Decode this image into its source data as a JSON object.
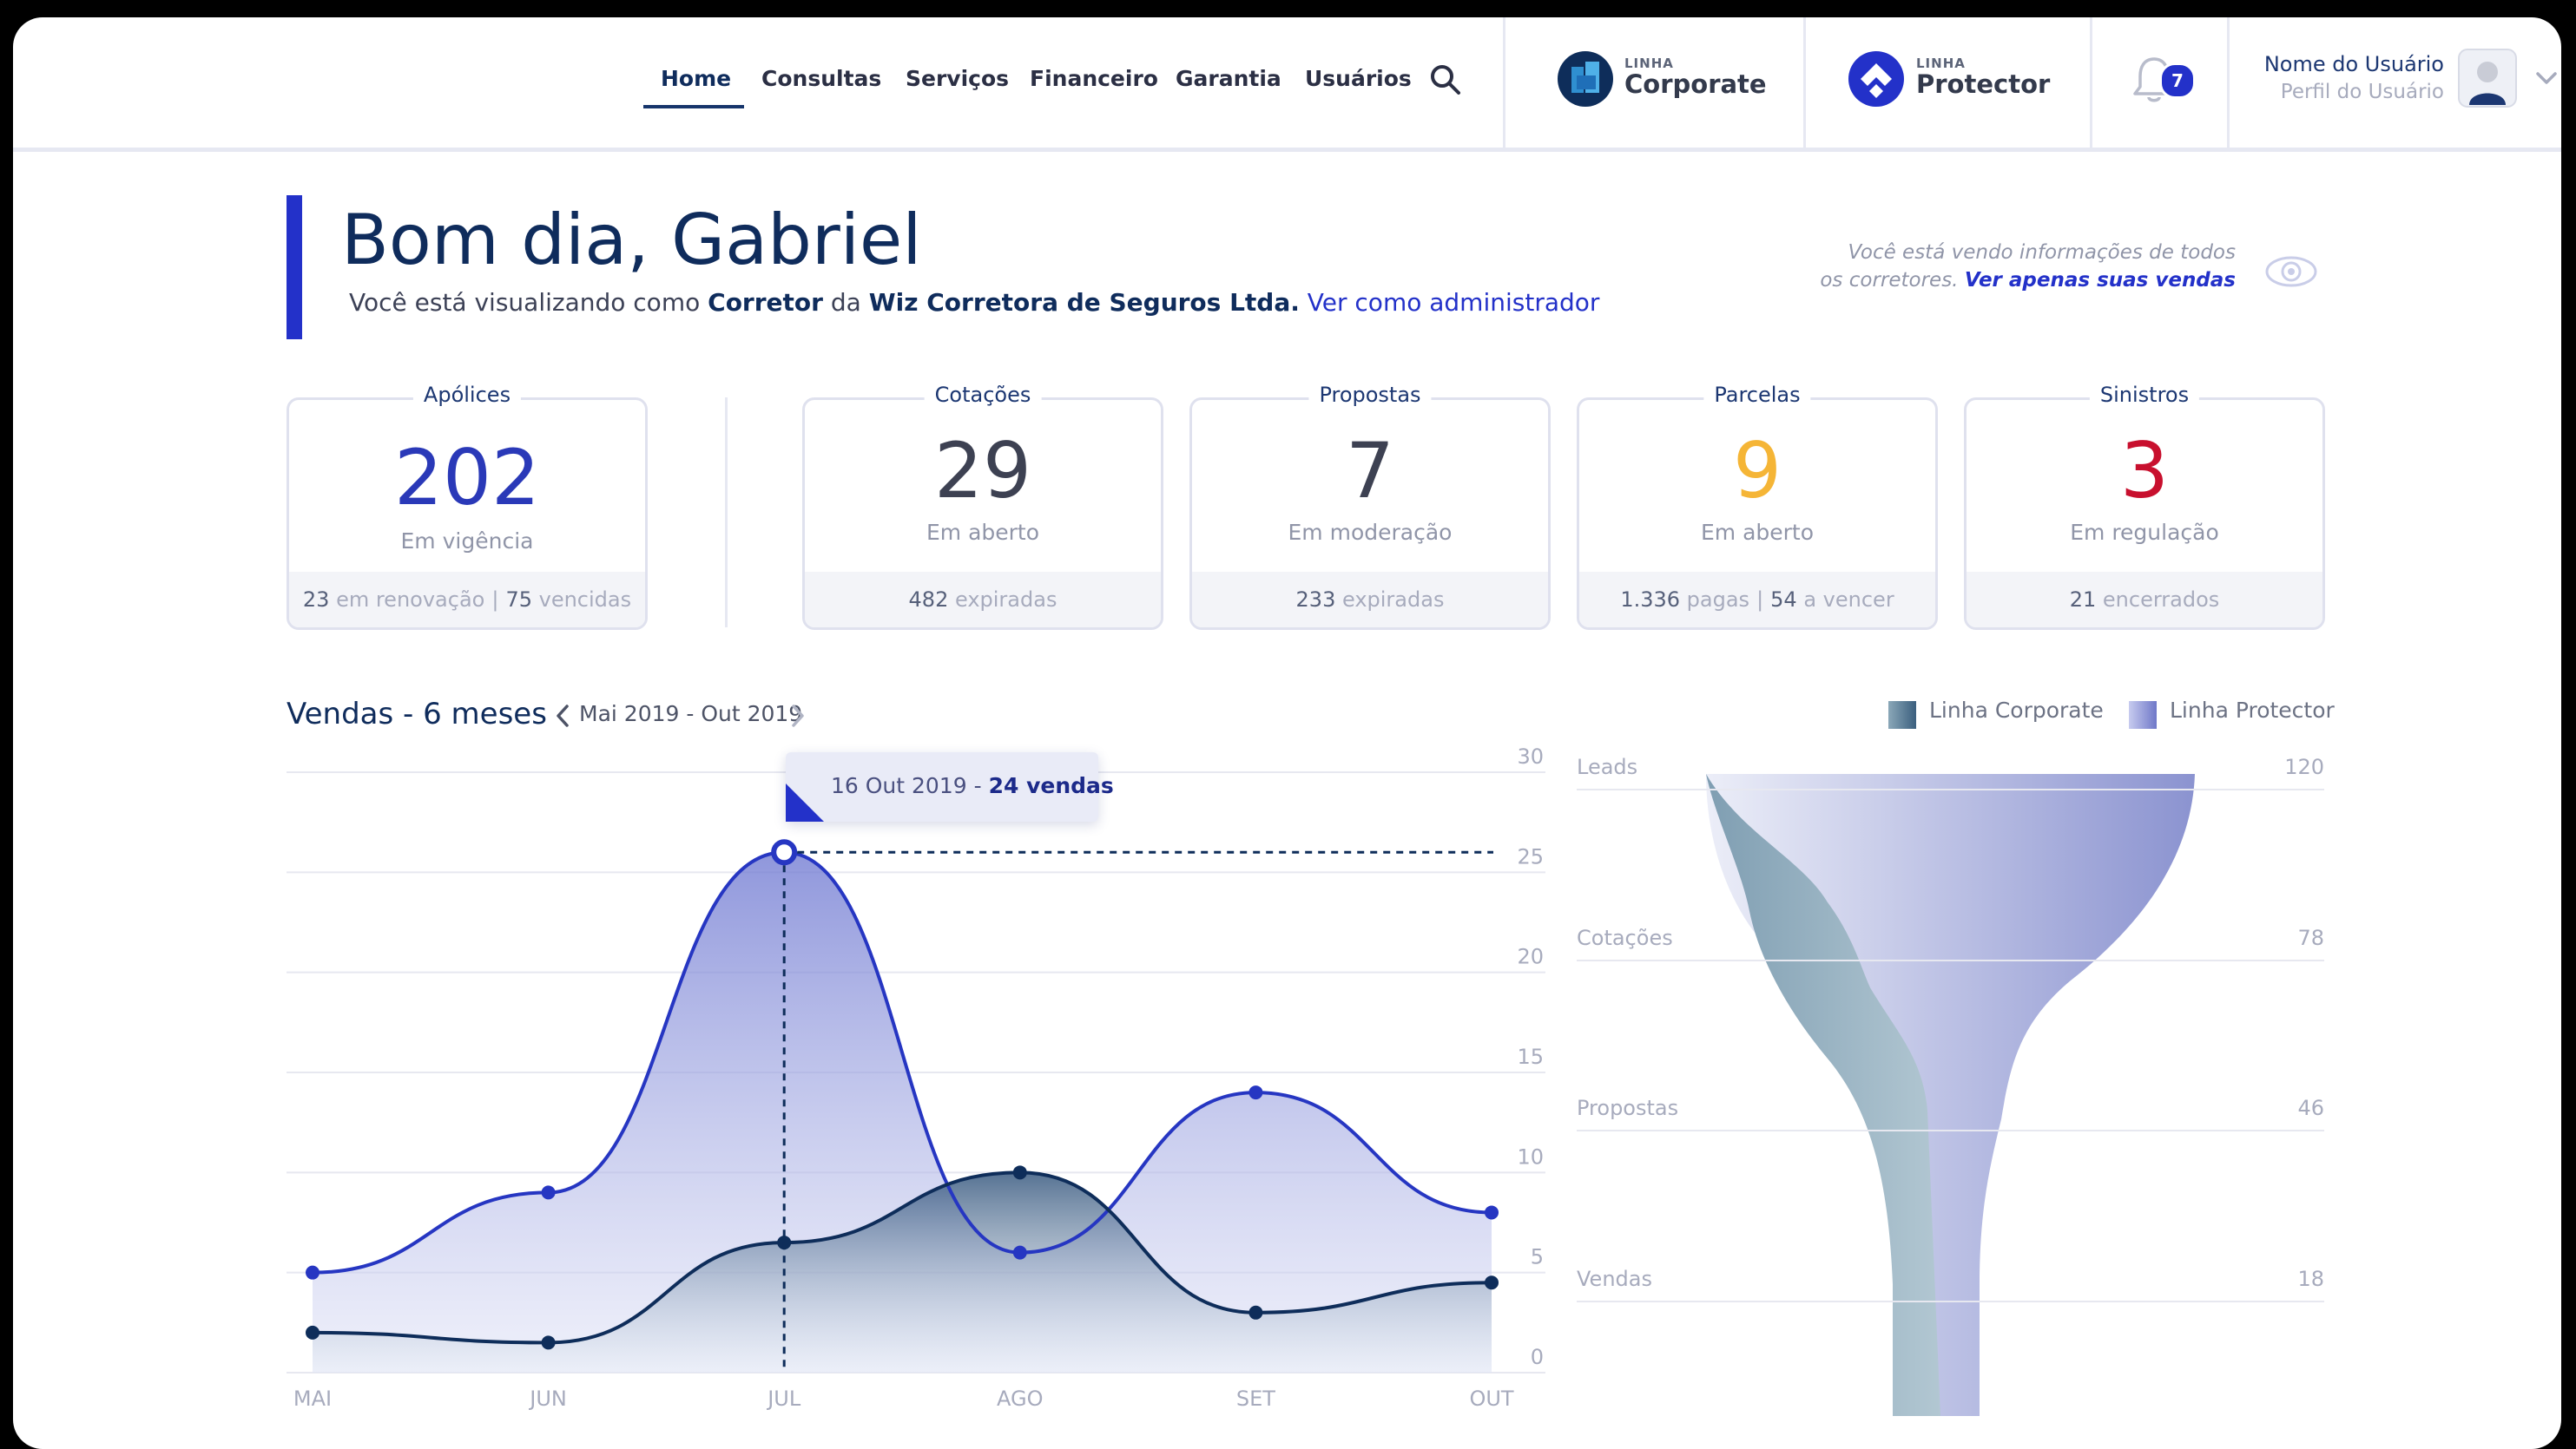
{
  "nav": {
    "items": [
      {
        "label": "Home",
        "active": true
      },
      {
        "label": "Consultas"
      },
      {
        "label": "Serviços"
      },
      {
        "label": "Financeiro"
      },
      {
        "label": "Garantia"
      },
      {
        "label": "Usuários"
      }
    ]
  },
  "brands": {
    "corporate": {
      "small": "LINHA",
      "name": "Corporate"
    },
    "protector": {
      "small": "LINHA",
      "name": "Protector"
    }
  },
  "notifications": {
    "count": "7"
  },
  "user": {
    "name": "Nome do Usuário",
    "role": "Perfil do Usuário"
  },
  "greeting": {
    "title": "Bom dia, Gabriel",
    "prefix": "Você está visualizando como",
    "role": "Corretor",
    "connector": "da",
    "company": "Wiz Corretora de Seguros Ltda.",
    "admin_link": "Ver como administrador"
  },
  "info_note": {
    "line1": "Você está vendo informações de todos",
    "line2_prefix": "os corretores.",
    "line2_link": "Ver apenas suas vendas"
  },
  "cards": [
    {
      "label": "Apólices",
      "value": "202",
      "value_color": "#2a39b8",
      "sub": "Em vigência",
      "foot": [
        {
          "num": "23",
          "txt": "em renovação"
        },
        {
          "sep": "|"
        },
        {
          "num": "75",
          "txt": "vencidas"
        }
      ]
    },
    {
      "label": "Cotações",
      "value": "29",
      "value_color": "#3d4152",
      "sub": "Em aberto",
      "foot": [
        {
          "num": "482",
          "txt": "expiradas"
        }
      ]
    },
    {
      "label": "Propostas",
      "value": "7",
      "value_color": "#3d4152",
      "sub": "Em moderação",
      "foot": [
        {
          "num": "233",
          "txt": "expiradas"
        }
      ]
    },
    {
      "label": "Parcelas",
      "value": "9",
      "value_color": "#f5b536",
      "sub": "Em aberto",
      "foot": [
        {
          "num": "1.336",
          "txt": "pagas"
        },
        {
          "sep": "|"
        },
        {
          "num": "54",
          "txt": "a vencer"
        }
      ]
    },
    {
      "label": "Sinistros",
      "value": "3",
      "value_color": "#c8102e",
      "sub": "Em regulação",
      "foot": [
        {
          "num": "21",
          "txt": "encerrados"
        }
      ]
    }
  ],
  "sales": {
    "title": "Vendas - 6 meses",
    "range": "Mai 2019 - Out 2019",
    "tooltip": {
      "date": "16 Out 2019",
      "sep": "-",
      "value": "24 vendas"
    },
    "legend": [
      {
        "name": "Linha Corporate",
        "color": "#6a8aa0"
      },
      {
        "name": "Linha Protector",
        "color": "#8a90d4"
      }
    ]
  },
  "chart_data": [
    {
      "type": "line",
      "categories": [
        "MAI",
        "JUN",
        "JUL",
        "AGO",
        "SET",
        "OUT"
      ],
      "ylim": [
        0,
        30
      ],
      "yticks": [
        0,
        5,
        10,
        15,
        20,
        25,
        30
      ],
      "series": [
        {
          "name": "Linha Protector",
          "values": [
            5,
            9,
            26,
            6,
            14,
            8
          ],
          "color": "#2636c2"
        },
        {
          "name": "Linha Corporate",
          "values": [
            2,
            1.5,
            6.5,
            10,
            3,
            4.5
          ],
          "color": "#0e2d5a"
        }
      ],
      "highlight": {
        "category": "JUL",
        "value": 26
      }
    },
    {
      "type": "funnel",
      "stages": [
        {
          "label": "Leads",
          "value": 120
        },
        {
          "label": "Cotações",
          "value": 78
        },
        {
          "label": "Propostas",
          "value": 46
        },
        {
          "label": "Vendas",
          "value": 18
        }
      ]
    }
  ]
}
